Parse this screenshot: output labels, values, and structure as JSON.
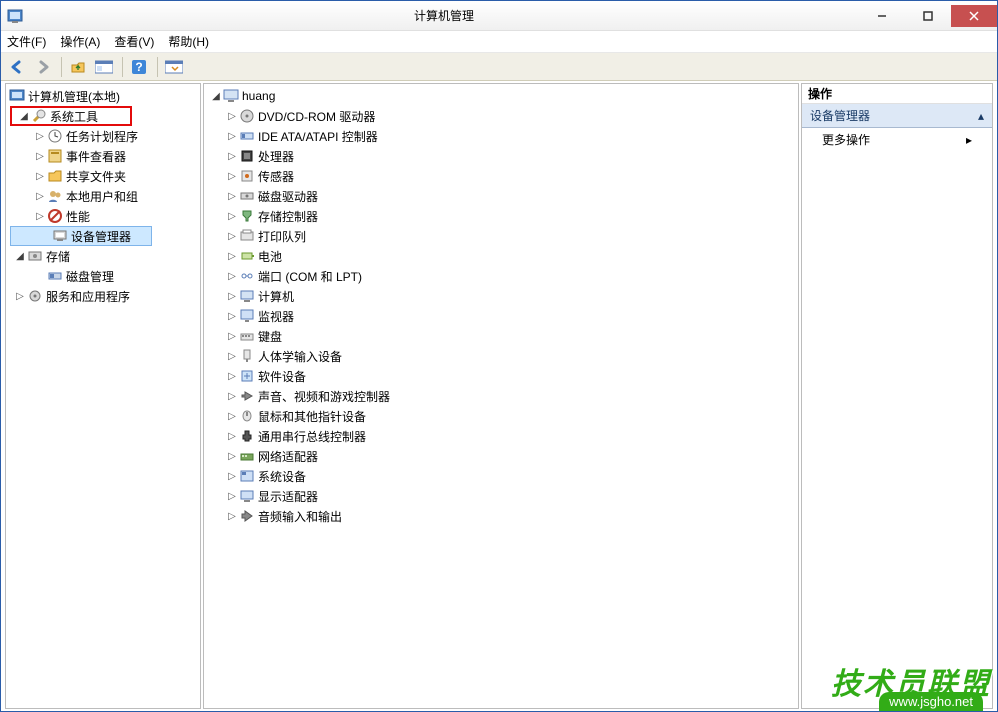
{
  "window": {
    "title": "计算机管理"
  },
  "menus": {
    "file": "文件(F)",
    "action": "操作(A)",
    "view": "查看(V)",
    "help": "帮助(H)"
  },
  "left_tree": {
    "root": "计算机管理(本地)",
    "system_tools": "系统工具",
    "task_scheduler": "任务计划程序",
    "event_viewer": "事件查看器",
    "shared_folders": "共享文件夹",
    "local_users": "本地用户和组",
    "performance": "性能",
    "device_manager": "设备管理器",
    "storage": "存储",
    "disk_mgmt": "磁盘管理",
    "services_apps": "服务和应用程序"
  },
  "mid_tree": {
    "root": "huang",
    "items": [
      "DVD/CD-ROM 驱动器",
      "IDE ATA/ATAPI 控制器",
      "处理器",
      "传感器",
      "磁盘驱动器",
      "存储控制器",
      "打印队列",
      "电池",
      "端口 (COM 和 LPT)",
      "计算机",
      "监视器",
      "键盘",
      "人体学输入设备",
      "软件设备",
      "声音、视频和游戏控制器",
      "鼠标和其他指针设备",
      "通用串行总线控制器",
      "网络适配器",
      "系统设备",
      "显示适配器",
      "音频输入和输出"
    ]
  },
  "actions": {
    "header": "操作",
    "section": "设备管理器",
    "more": "更多操作"
  },
  "watermark": {
    "text": "技术员联盟",
    "url": "www.jsgho.net"
  }
}
